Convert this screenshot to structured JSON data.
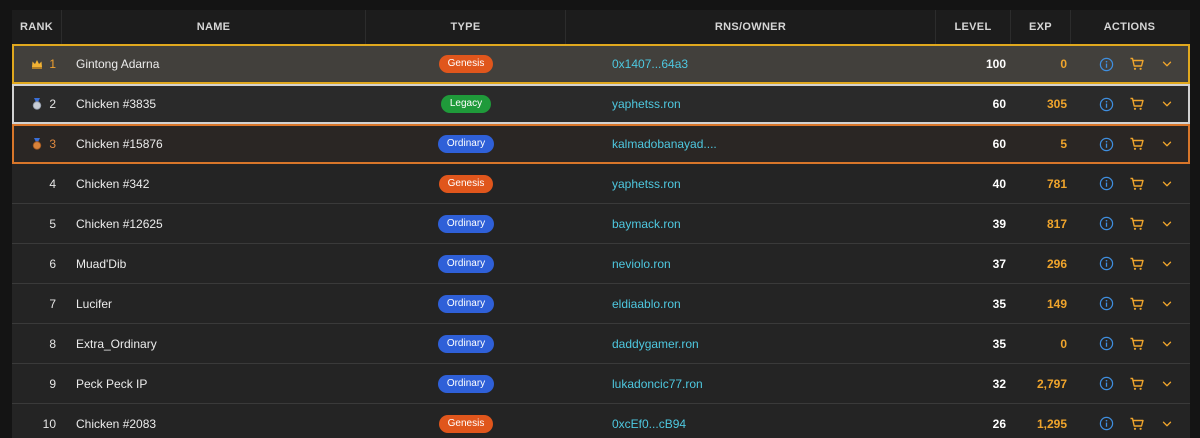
{
  "header": {
    "rank": "RANK",
    "name": "NAME",
    "type": "TYPE",
    "owner": "RNS/OWNER",
    "level": "LEVEL",
    "exp": "EXP",
    "actions": "ACTIONS"
  },
  "colors": {
    "genesis": "#e0561c",
    "legacy": "#1f9a3a",
    "ordinary": "#2f60d8",
    "owner_link": "#4ec8e0",
    "exp": "#f0a52c",
    "rank1_border": "#e0a81e",
    "rank2_border": "#d2d2d2",
    "rank3_border": "#d8762a",
    "action_icon": "#3f8fe0"
  },
  "rows": [
    {
      "rank": "1",
      "name": "Gintong Adarna",
      "type": "Genesis",
      "owner": "0x1407...64a3",
      "level": "100",
      "exp": "0",
      "rank_icon": "crown-icon"
    },
    {
      "rank": "2",
      "name": "Chicken #3835",
      "type": "Legacy",
      "owner": "yaphetss.ron",
      "level": "60",
      "exp": "305",
      "rank_icon": "silver-medal-icon"
    },
    {
      "rank": "3",
      "name": "Chicken #15876",
      "type": "Ordinary",
      "owner": "kalmadobanayad....",
      "level": "60",
      "exp": "5",
      "rank_icon": "bronze-medal-icon"
    },
    {
      "rank": "4",
      "name": "Chicken #342",
      "type": "Genesis",
      "owner": "yaphetss.ron",
      "level": "40",
      "exp": "781"
    },
    {
      "rank": "5",
      "name": "Chicken #12625",
      "type": "Ordinary",
      "owner": "baymack.ron",
      "level": "39",
      "exp": "817"
    },
    {
      "rank": "6",
      "name": "Muad'Dib",
      "type": "Ordinary",
      "owner": "neviolo.ron",
      "level": "37",
      "exp": "296"
    },
    {
      "rank": "7",
      "name": "Lucifer",
      "type": "Ordinary",
      "owner": "eldiaablo.ron",
      "level": "35",
      "exp": "149"
    },
    {
      "rank": "8",
      "name": "Extra_Ordinary",
      "type": "Ordinary",
      "owner": "daddygamer.ron",
      "level": "35",
      "exp": "0"
    },
    {
      "rank": "9",
      "name": "Peck Peck IP",
      "type": "Ordinary",
      "owner": "lukadoncic77.ron",
      "level": "32",
      "exp": "2,797"
    },
    {
      "rank": "10",
      "name": "Chicken #2083",
      "type": "Genesis",
      "owner": "0xcEf0...cB94",
      "level": "26",
      "exp": "1,295"
    }
  ]
}
